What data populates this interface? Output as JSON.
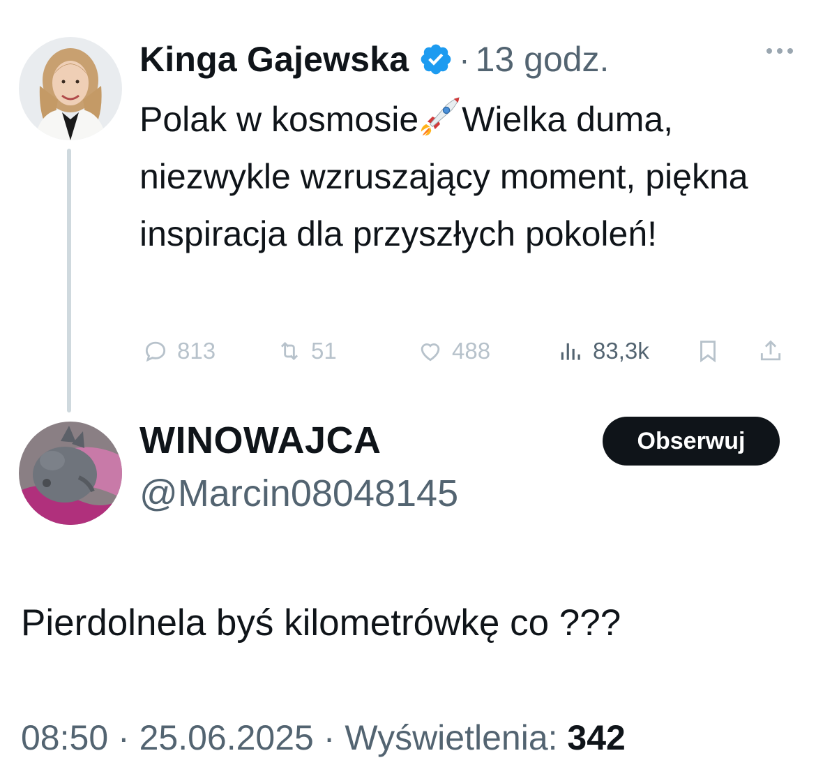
{
  "original_tweet": {
    "author_name": "Kinga Gajewska",
    "verified_icon": "verified-badge-icon",
    "separator": "·",
    "time_ago": "13 godz.",
    "more_icon": "more-options-icon",
    "text_part1": "Polak w kosmosie",
    "emoji": "rocket-emoji",
    "text_part2": "Wielka duma, niezwykle wzruszający moment, piękna inspiracja dla przyszłych pokoleń!",
    "actions": {
      "replies": "813",
      "retweets": "51",
      "likes": "488",
      "views": "83,3k"
    }
  },
  "reply": {
    "display_name": "WINOWAJCA",
    "handle": "@Marcin08048145",
    "follow_label": "Obserwuj",
    "text": "Pierdolnela byś kilometrówkę co ???",
    "time": "08:50",
    "date": "25.06.2025",
    "separator": "·",
    "views_label": "Wyświetlenia:",
    "views_count": "342"
  },
  "colors": {
    "text_primary": "#0f1419",
    "text_secondary": "#536471",
    "verified_blue": "#1d9bf0",
    "thread_line": "#cfd9de",
    "faded_action": "#b7c2cb",
    "button_bg": "#0f1419"
  }
}
